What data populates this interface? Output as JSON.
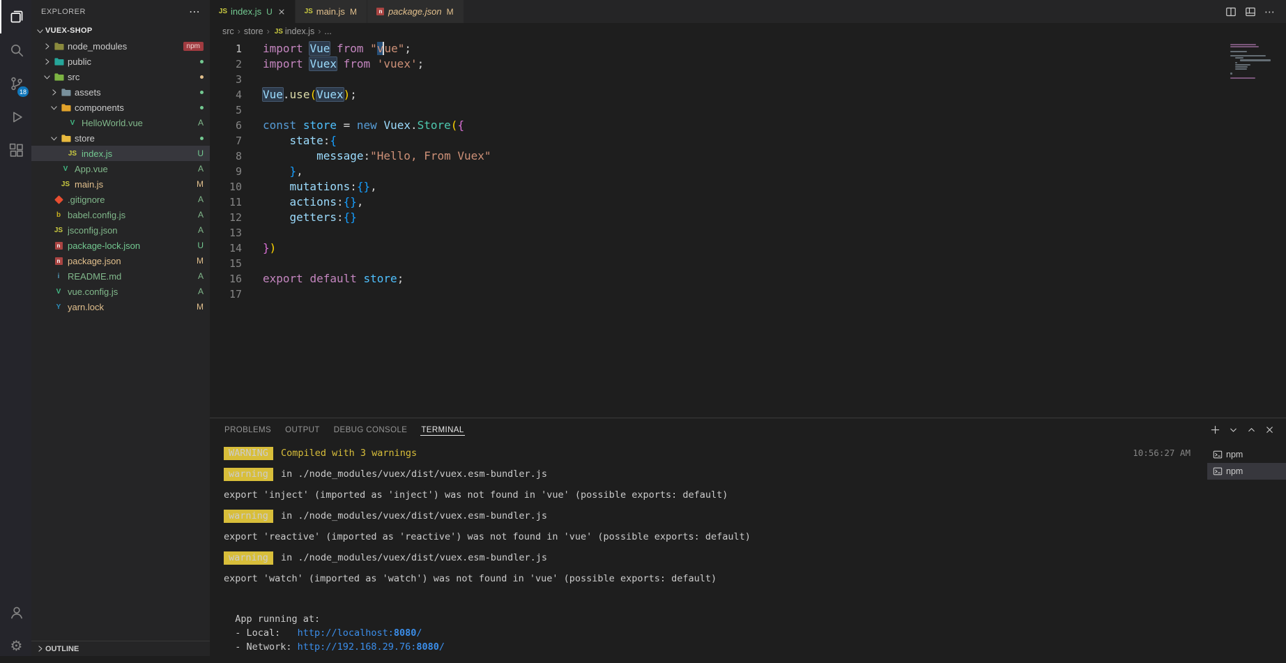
{
  "activity_bar": {
    "items": [
      {
        "name": "explorer",
        "active": true
      },
      {
        "name": "search"
      },
      {
        "name": "source-control",
        "badge": "18"
      },
      {
        "name": "run-debug"
      },
      {
        "name": "extensions"
      }
    ],
    "bottom": [
      {
        "name": "account"
      },
      {
        "name": "settings"
      }
    ]
  },
  "explorer": {
    "title": "EXPLORER",
    "more": "⋯",
    "section": "VUEX-SHOP",
    "outline": "OUTLINE",
    "tree": [
      {
        "name": "node_modules",
        "kind": "folder",
        "depth": 0,
        "expanded": false,
        "color": "#8a8a3d",
        "badge": "npm"
      },
      {
        "name": "public",
        "kind": "folder",
        "depth": 0,
        "expanded": false,
        "color": "#26a69a",
        "dot": "#73c991"
      },
      {
        "name": "src",
        "kind": "folder",
        "depth": 0,
        "expanded": true,
        "color": "#7cb342",
        "dot": "#e2c08d"
      },
      {
        "name": "assets",
        "kind": "folder",
        "depth": 1,
        "expanded": false,
        "color": "#78909c",
        "dot": "#73c991"
      },
      {
        "name": "components",
        "kind": "folder",
        "depth": 1,
        "expanded": true,
        "color": "#e2a32b",
        "dot": "#73c991"
      },
      {
        "name": "HelloWorld.vue",
        "kind": "file",
        "depth": 2,
        "icon": "vue",
        "git": "A"
      },
      {
        "name": "store",
        "kind": "folder",
        "depth": 1,
        "expanded": true,
        "color": "#e8b93e",
        "dot": "#73c991"
      },
      {
        "name": "index.js",
        "kind": "file",
        "depth": 2,
        "icon": "js",
        "git": "U",
        "selected": true
      },
      {
        "name": "App.vue",
        "kind": "file",
        "depth": 1,
        "icon": "vue",
        "git": "A"
      },
      {
        "name": "main.js",
        "kind": "file",
        "depth": 1,
        "icon": "js",
        "git": "M"
      },
      {
        "name": ".gitignore",
        "kind": "file",
        "depth": 0,
        "icon": "git",
        "git": "A"
      },
      {
        "name": "babel.config.js",
        "kind": "file",
        "depth": 0,
        "icon": "babel",
        "git": "A"
      },
      {
        "name": "jsconfig.json",
        "kind": "file",
        "depth": 0,
        "icon": "jsconfig",
        "git": "A"
      },
      {
        "name": "package-lock.json",
        "kind": "file",
        "depth": 0,
        "icon": "npm",
        "git": "U"
      },
      {
        "name": "package.json",
        "kind": "file",
        "depth": 0,
        "icon": "npm",
        "git": "M"
      },
      {
        "name": "README.md",
        "kind": "file",
        "depth": 0,
        "icon": "readme",
        "git": "A"
      },
      {
        "name": "vue.config.js",
        "kind": "file",
        "depth": 0,
        "icon": "vue-config",
        "git": "A"
      },
      {
        "name": "yarn.lock",
        "kind": "file",
        "depth": 0,
        "icon": "yarn",
        "git": "M"
      }
    ]
  },
  "editor_tabs": [
    {
      "label": "index.js",
      "icon": "js",
      "git": "U",
      "active": true,
      "close": true
    },
    {
      "label": "main.js",
      "icon": "js",
      "git": "M"
    },
    {
      "label": "package.json",
      "icon": "npm",
      "git": "M",
      "italic": true
    }
  ],
  "editor_actions": [
    {
      "name": "split-editor"
    },
    {
      "name": "customize-layout"
    },
    {
      "name": "more-actions",
      "glyph": "⋯"
    }
  ],
  "breadcrumb": {
    "items": [
      {
        "label": "src"
      },
      {
        "label": "store"
      },
      {
        "label": "index.js",
        "icon": "js"
      },
      {
        "label": "..."
      }
    ]
  },
  "editor": {
    "lines": [
      [
        {
          "t": "import",
          "c": "k"
        },
        {
          "t": " "
        },
        {
          "t": "Vue",
          "c": "v",
          "hl": "occ"
        },
        {
          "t": " "
        },
        {
          "t": "from",
          "c": "k"
        },
        {
          "t": " "
        },
        {
          "t": "\"",
          "c": "s"
        },
        {
          "t": "v",
          "c": "s",
          "hl": "sel",
          "cursor": true
        },
        {
          "t": "ue\"",
          "c": "s"
        },
        {
          "t": ";",
          "c": "p"
        }
      ],
      [
        {
          "t": "import",
          "c": "k"
        },
        {
          "t": " "
        },
        {
          "t": "Vuex",
          "c": "v",
          "hl": "occ"
        },
        {
          "t": " "
        },
        {
          "t": "from",
          "c": "k"
        },
        {
          "t": " "
        },
        {
          "t": "'vuex'",
          "c": "s"
        },
        {
          "t": ";",
          "c": "p"
        }
      ],
      [],
      [
        {
          "t": "Vue",
          "c": "v",
          "hl": "occ"
        },
        {
          "t": ".",
          "c": "p"
        },
        {
          "t": "use",
          "c": "f"
        },
        {
          "t": "(",
          "c": "b1"
        },
        {
          "t": "Vuex",
          "c": "v",
          "hl": "occ"
        },
        {
          "t": ")",
          "c": "b1"
        },
        {
          "t": ";",
          "c": "p"
        }
      ],
      [],
      [
        {
          "t": "const",
          "c": "b"
        },
        {
          "t": " "
        },
        {
          "t": "store",
          "c": "cst"
        },
        {
          "t": " "
        },
        {
          "t": "=",
          "c": "p"
        },
        {
          "t": " "
        },
        {
          "t": "new",
          "c": "b"
        },
        {
          "t": " "
        },
        {
          "t": "Vuex",
          "c": "v"
        },
        {
          "t": ".",
          "c": "p"
        },
        {
          "t": "Store",
          "c": "ty"
        },
        {
          "t": "(",
          "c": "b1"
        },
        {
          "t": "{",
          "c": "b2"
        }
      ],
      [
        {
          "t": "    "
        },
        {
          "t": "state",
          "c": "v"
        },
        {
          "t": ":",
          "c": "p"
        },
        {
          "t": "{",
          "c": "b3"
        }
      ],
      [
        {
          "t": "        "
        },
        {
          "t": "message",
          "c": "v"
        },
        {
          "t": ":",
          "c": "p"
        },
        {
          "t": "\"Hello, From Vuex\"",
          "c": "s"
        }
      ],
      [
        {
          "t": "    "
        },
        {
          "t": "}",
          "c": "b3"
        },
        {
          "t": ",",
          "c": "p"
        }
      ],
      [
        {
          "t": "    "
        },
        {
          "t": "mutations",
          "c": "v"
        },
        {
          "t": ":",
          "c": "p"
        },
        {
          "t": "{}",
          "c": "b3"
        },
        {
          "t": ",",
          "c": "p"
        }
      ],
      [
        {
          "t": "    "
        },
        {
          "t": "actions",
          "c": "v"
        },
        {
          "t": ":",
          "c": "p"
        },
        {
          "t": "{}",
          "c": "b3"
        },
        {
          "t": ",",
          "c": "p"
        }
      ],
      [
        {
          "t": "    "
        },
        {
          "t": "getters",
          "c": "v"
        },
        {
          "t": ":",
          "c": "p"
        },
        {
          "t": "{}",
          "c": "b3"
        }
      ],
      [],
      [
        {
          "t": "}",
          "c": "b2"
        },
        {
          "t": ")",
          "c": "b1"
        }
      ],
      [],
      [
        {
          "t": "export",
          "c": "k"
        },
        {
          "t": " "
        },
        {
          "t": "default",
          "c": "k"
        },
        {
          "t": " "
        },
        {
          "t": "store",
          "c": "cst"
        },
        {
          "t": ";",
          "c": "p"
        }
      ],
      []
    ]
  },
  "panel": {
    "tabs": [
      {
        "label": "PROBLEMS"
      },
      {
        "label": "OUTPUT"
      },
      {
        "label": "DEBUG CONSOLE"
      },
      {
        "label": "TERMINAL",
        "active": true
      }
    ],
    "actions": [
      {
        "name": "new-terminal",
        "icon": "plus"
      },
      {
        "name": "launch-profile-dropdown",
        "icon": "chevron-down"
      },
      {
        "name": "maximize-panel",
        "icon": "chevron-up"
      },
      {
        "name": "close-panel",
        "icon": "close"
      }
    ],
    "timestamp": "10:56:27 AM",
    "terminal": {
      "lines": [
        {
          "type": "row",
          "timestamp": true,
          "segments": [
            {
              "badge": "WARNING"
            },
            {
              "t": " Compiled with 3 warnings",
              "c": "warn"
            }
          ]
        },
        {
          "type": "row",
          "segments": [
            {
              "badge": "warning"
            },
            {
              "t": " in ./node_modules/vuex/dist/vuex.esm-bundler.js"
            }
          ]
        },
        {
          "type": "row",
          "segments": [
            {
              "t": "export 'inject' (imported as 'inject') was not found in 'vue' (possible exports: default)"
            }
          ]
        },
        {
          "type": "row",
          "segments": [
            {
              "badge": "warning"
            },
            {
              "t": " in ./node_modules/vuex/dist/vuex.esm-bundler.js"
            }
          ]
        },
        {
          "type": "row",
          "segments": [
            {
              "t": "export 'reactive' (imported as 'reactive') was not found in 'vue' (possible exports: default)"
            }
          ]
        },
        {
          "type": "row",
          "segments": [
            {
              "badge": "warning"
            },
            {
              "t": " in ./node_modules/vuex/dist/vuex.esm-bundler.js"
            }
          ]
        },
        {
          "type": "row",
          "segments": [
            {
              "t": "export 'watch' (imported as 'watch') was not found in 'vue' (possible exports: default)"
            }
          ]
        },
        {
          "type": "gap"
        },
        {
          "type": "row",
          "tight": true,
          "segments": [
            {
              "t": "  App running at:"
            }
          ]
        },
        {
          "type": "row",
          "tight": true,
          "segments": [
            {
              "t": "  - Local:   "
            },
            {
              "t": "http://localhost:",
              "c": "link"
            },
            {
              "t": "8080",
              "c": "linkb"
            },
            {
              "t": "/",
              "c": "link"
            }
          ]
        },
        {
          "type": "row",
          "tight": true,
          "segments": [
            {
              "t": "  - Network: "
            },
            {
              "t": "http://192.168.29.76:",
              "c": "link"
            },
            {
              "t": "8080",
              "c": "linkb"
            },
            {
              "t": "/",
              "c": "link"
            }
          ]
        }
      ],
      "list": [
        {
          "label": "npm"
        },
        {
          "label": "npm",
          "selected": true
        }
      ]
    }
  }
}
